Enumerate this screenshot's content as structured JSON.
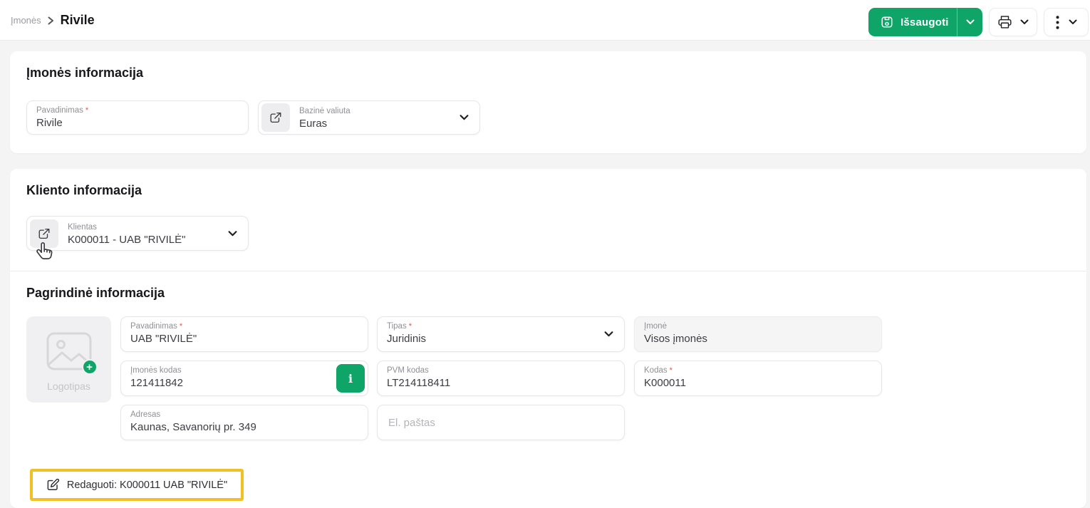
{
  "ui": {
    "required_mark": "*"
  },
  "colors": {
    "accent_green": "#0FA468",
    "highlight_yellow": "#F0C024",
    "required_red": "#E0524F"
  },
  "header": {
    "breadcrumb_parent": "Įmonės",
    "title": "Rivile",
    "save_label": "Išsaugoti"
  },
  "company_section": {
    "title": "Įmonės informacija",
    "name_label": "Pavadinimas",
    "name_value": "Rivile",
    "currency_label": "Bazinė valiuta",
    "currency_value": "Euras"
  },
  "client_section": {
    "title": "Kliento informacija",
    "client_label": "Klientas",
    "client_value": "K000011 - UAB \"RIVILĖ\""
  },
  "main_section": {
    "title": "Pagrindinė informacija",
    "logo_label": "Logotipas",
    "name_label": "Pavadinimas",
    "name_value": "UAB \"RIVILĖ\"",
    "type_label": "Tipas",
    "type_value": "Juridinis",
    "company_label": "Įmonė",
    "company_value": "Visos įmonės",
    "company_code_label": "Įmonės kodas",
    "company_code_value": "121411842",
    "info_button_label": "i",
    "vat_label": "PVM kodas",
    "vat_value": "LT214118411",
    "code_label": "Kodas",
    "code_value": "K000011",
    "address_label": "Adresas",
    "address_value": "Kaunas, Savanorių pr. 349",
    "email_placeholder": "El. paštas",
    "edit_button_label": "Redaguoti: K000011 UAB \"RIVILĖ\""
  }
}
